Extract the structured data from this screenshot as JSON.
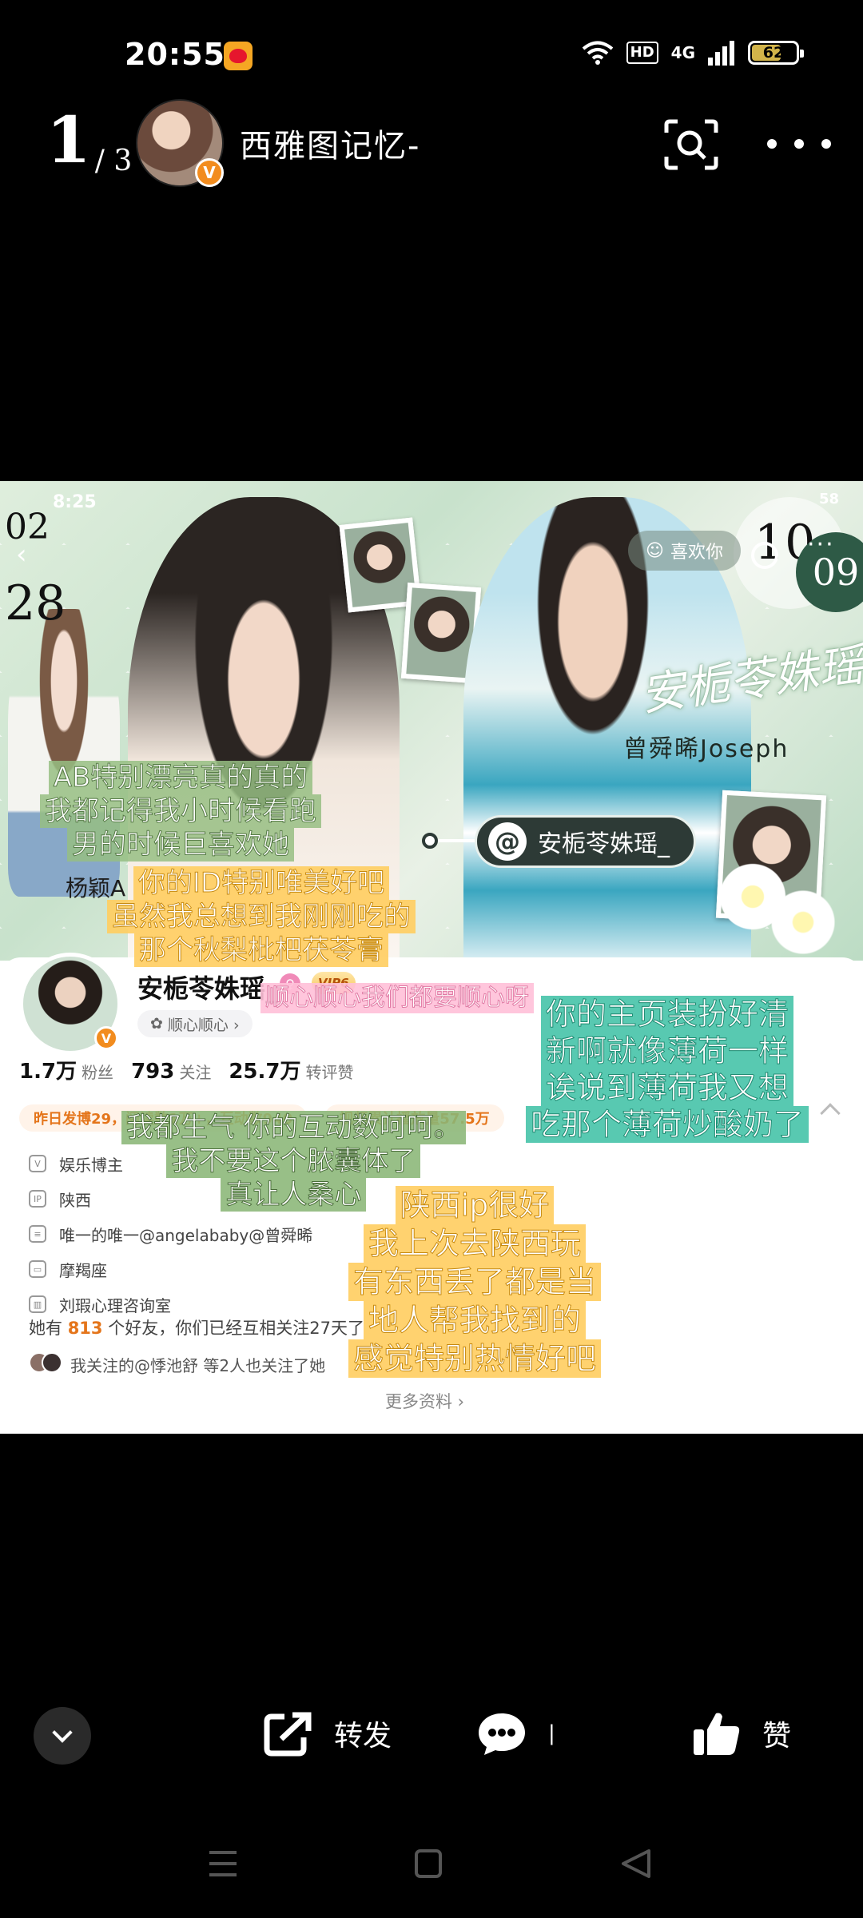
{
  "status_bar": {
    "time": "20:55",
    "signal": "4G",
    "hd": "HD",
    "battery": "62",
    "battery_level": 0.62
  },
  "header": {
    "page_current": "1",
    "page_total": "/ 3",
    "username": "西雅图记忆-"
  },
  "banner": {
    "time": "8:25",
    "status_battery": "58",
    "date_top": "02",
    "date_bottom": "28",
    "like_label": "喜欢你",
    "clock_number": "10",
    "circle_number": "09",
    "script_title": "安栀苓姝瑶",
    "subtitle": "曾舜晞Joseph",
    "handle_pill": "安栀苓姝瑶_",
    "name_tag": "杨颖A"
  },
  "profile": {
    "name": "安栀苓姝瑶_",
    "vip": "VIP6",
    "sub_tag": "顺心顺心 ›",
    "stats": [
      {
        "value": "1.7万",
        "label": "粉丝"
      },
      {
        "value": "793",
        "label": "关注"
      },
      {
        "value": "25.7万",
        "label": "转评赞"
      }
    ],
    "chips": [
      "昨日发博29，阅读数1万+，互动数940",
      "视频累计播放量57.5万"
    ],
    "info": [
      {
        "icon": "V",
        "text": "娱乐博主"
      },
      {
        "icon": "IP",
        "text": "陕西"
      },
      {
        "icon": "",
        "text": "唯一的唯一@angelababy@曾舜晞"
      },
      {
        "icon": "",
        "text": "摩羯座"
      },
      {
        "icon": "",
        "text": "刘瑕心理咨询室"
      }
    ],
    "friends_prefix": "她有",
    "friends_count": "813",
    "friends_suffix": "个好友，你们已经互相关注27天了",
    "mutual": "我关注的@悸池舒 等2人也关注了她",
    "more": "更多资料 ›"
  },
  "captions": {
    "ab": [
      "AB特别漂亮真的真的",
      "我都记得我小时候看跑",
      "男的时候巨喜欢她"
    ],
    "id": [
      "你的ID特别唯美好吧",
      "虽然我总想到我刚刚吃的",
      "那个秋梨枇杷茯苓膏"
    ],
    "pink": [
      "顺心顺心我们都要顺心呀"
    ],
    "teal": [
      "你的主页装扮好清",
      "新啊就像薄荷一样",
      "诶说到薄荷我又想",
      "吃那个薄荷炒酸奶了"
    ],
    "angry": [
      "我都生气 你的互动数呵呵。",
      "我不要这个脓囊体了",
      "真让人桑心"
    ],
    "shaanxi": [
      "陕西ip很好",
      "我上次去陕西玩",
      "有东西丢了都是当",
      "地人帮我找到的",
      "感觉特别热情好吧"
    ]
  },
  "toolbar": {
    "repost": "转发",
    "comment": "|",
    "like": "赞"
  },
  "colors": {
    "accent_orange": "#e4751b",
    "weibo_red": "#e6162d",
    "verify_orange": "#f28c1e"
  }
}
